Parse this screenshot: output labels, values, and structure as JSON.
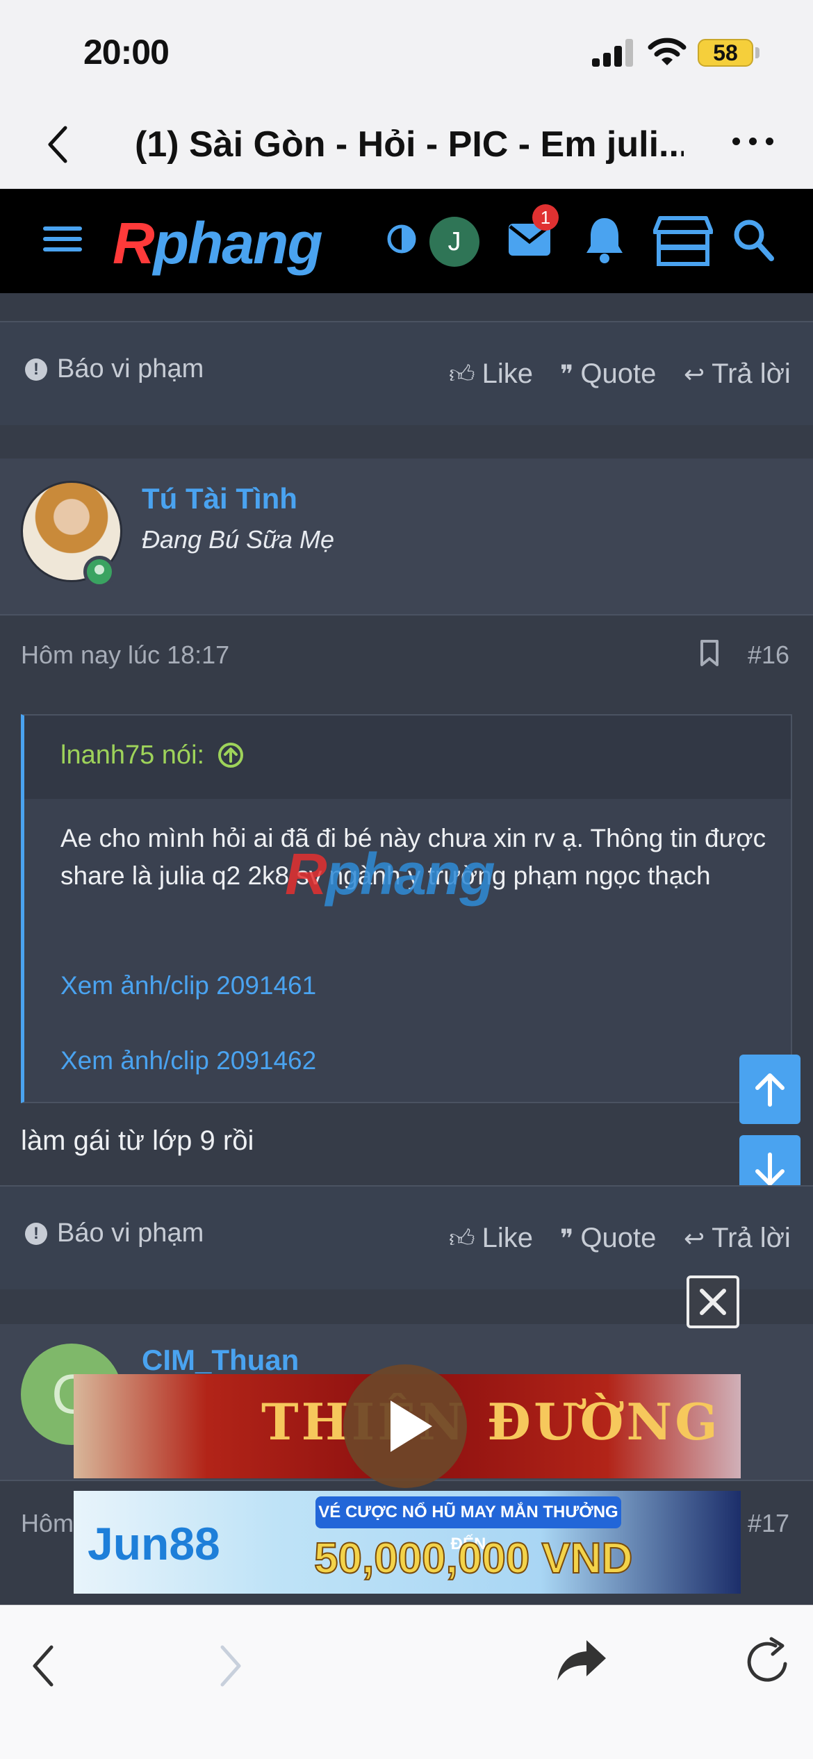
{
  "status_bar": {
    "time": "20:00",
    "battery": "58"
  },
  "browser": {
    "page_title": "(1) Sài Gòn - Hỏi - PIC - Em juli..."
  },
  "site": {
    "logo_r": "R",
    "logo_rest": "phang",
    "user_initial": "J",
    "mail_badge": "1"
  },
  "actions": {
    "report": "Báo vi phạm",
    "like": "Like",
    "quote": "Quote",
    "reply": "Trả lời"
  },
  "post": {
    "username": "Tú Tài Tình",
    "user_title": "Đang Bú Sữa Mẹ",
    "date": "Hôm nay lúc 18:17",
    "number": "#16",
    "quote_author": "lnanh75 nói:",
    "quote_text": "Ae cho mình hỏi ai đã đi bé này chưa xin rv ạ. Thông tin được share là julia q2 2k8 sv ngành y trường phạm ngọc thạch",
    "quote_link_1": "Xem ảnh/clip 2091461",
    "quote_link_2": "Xem ảnh/clip 2091462",
    "text": "làm gái từ lớp 9 rồi"
  },
  "next_post": {
    "avatar_letter": "C",
    "username": "CIM_Thuan",
    "date": "Hôm",
    "number": "#17"
  },
  "ads": {
    "top_text": "THIÊN ĐƯỜNG",
    "brand": "Jun88",
    "tag": "VÉ CƯỢC NỔ HŨ MAY MẮN THƯỞNG ĐẾN",
    "amount": "50,000,000 VND"
  },
  "colors": {
    "accent": "#4aa3f0",
    "background": "#363c48",
    "quote_author": "#9ed35a",
    "logo_red": "#ff3a3a"
  },
  "icons": {
    "header": [
      "hamburger-icon",
      "contrast-icon",
      "mail-icon",
      "bell-icon",
      "store-icon",
      "search-icon"
    ],
    "post": [
      "bookmark-icon",
      "thumbs-up-icon",
      "quote-icon",
      "reply-icon",
      "report-icon"
    ],
    "toolbar": [
      "back-icon",
      "forward-icon",
      "share-icon",
      "reload-icon"
    ]
  }
}
